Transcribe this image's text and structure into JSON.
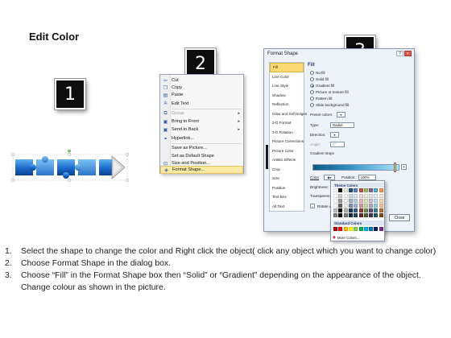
{
  "title": "Edit Color",
  "steps": [
    "1",
    "2",
    "3"
  ],
  "context_menu": {
    "items": [
      {
        "label": "Cut",
        "icon": "scissors-icon",
        "enabled": true
      },
      {
        "label": "Copy",
        "icon": "copy-icon",
        "enabled": true
      },
      {
        "label": "Paste",
        "icon": "paste-icon",
        "enabled": true
      },
      {
        "label": "Edit Text",
        "icon": "edit-text-icon",
        "enabled": true
      },
      {
        "label": "Group",
        "icon": "group-icon",
        "enabled": false,
        "submenu": true
      },
      {
        "label": "Bring to Front",
        "icon": "bring-front-icon",
        "enabled": true,
        "submenu": true
      },
      {
        "label": "Send to Back",
        "icon": "send-back-icon",
        "enabled": true,
        "submenu": true
      },
      {
        "label": "Hyperlink...",
        "icon": "hyperlink-icon",
        "enabled": true
      },
      {
        "label": "Save as Picture...",
        "icon": "",
        "enabled": true
      },
      {
        "label": "Set as Default Shape",
        "icon": "",
        "enabled": true
      },
      {
        "label": "Size and Position...",
        "icon": "size-position-icon",
        "enabled": true
      },
      {
        "label": "Format Shape...",
        "icon": "format-shape-icon",
        "enabled": true,
        "highlighted": true
      }
    ]
  },
  "dialog": {
    "title": "Format Shape",
    "window_buttons": [
      "?",
      "×"
    ],
    "nav_items": [
      "Fill",
      "Line Color",
      "Line Style",
      "Shadow",
      "Reflection",
      "Glow and Soft Edges",
      "3-D Format",
      "3-D Rotation",
      "Picture Corrections",
      "Picture Color",
      "Artistic Effects",
      "Crop",
      "Size",
      "Position",
      "Text Box",
      "Alt Text"
    ],
    "selected_nav": "Fill",
    "section_title": "Fill",
    "fill_options": [
      {
        "label": "No fill",
        "selected": false
      },
      {
        "label": "Solid fill",
        "selected": false
      },
      {
        "label": "Gradient fill",
        "selected": true
      },
      {
        "label": "Picture or texture fill",
        "selected": false
      },
      {
        "label": "Pattern fill",
        "selected": false
      },
      {
        "label": "Slide background fill",
        "selected": false
      }
    ],
    "preset_colors_label": "Preset colors:",
    "type_label": "Type:",
    "type_value": "Radial",
    "direction_label": "Direction:",
    "angle_label": "Angle:",
    "angle_value": "0°",
    "gradient_stops_label": "Gradient stops",
    "color_label": "Color",
    "position_label": "Position:",
    "position_value": "100%",
    "brightness_label": "Brightness:",
    "transparency_label": "Transparency:",
    "rotate_label": "Rotate with shape",
    "close_label": "Close"
  },
  "palette": {
    "theme_header": "Theme Colors",
    "standard_header": "Standard Colors",
    "more_colors": "More Colors...",
    "theme_top": [
      "#ffffff",
      "#000000",
      "#eeece1",
      "#1f497d",
      "#4f81bd",
      "#c0504d",
      "#9bbb59",
      "#8064a2",
      "#4bacc6",
      "#f79646"
    ],
    "standard": [
      "#c00000",
      "#ff0000",
      "#ffc000",
      "#ffff00",
      "#92d050",
      "#00b050",
      "#00b0f0",
      "#0070c0",
      "#002060",
      "#7030a0"
    ]
  },
  "instructions": [
    {
      "num": "1.",
      "text": "Select the shape to change the color and Right click the object( click any object which you want to change color)"
    },
    {
      "num": "2.",
      "text": "Choose Format Shape in the dialog box."
    },
    {
      "num": "3.",
      "text": "Choose “Fill” in the Format Shape box then “Solid” or “Gradient” depending on the appearance of the object. Change colour as shown in the picture."
    }
  ]
}
